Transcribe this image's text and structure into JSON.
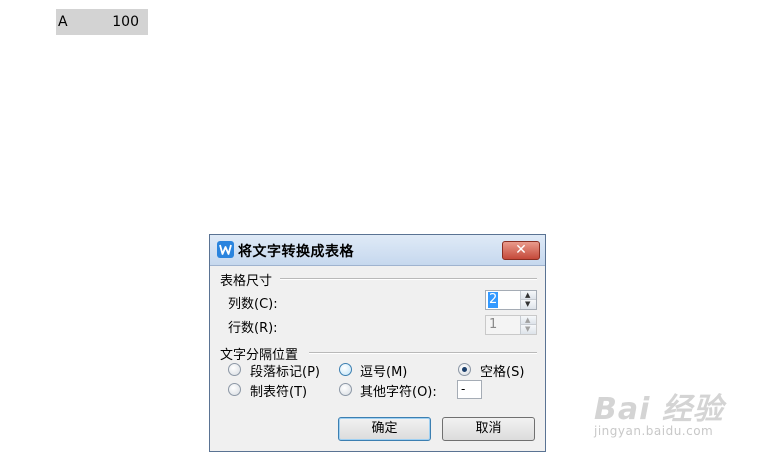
{
  "document": {
    "row": {
      "col1": "A",
      "col2": "100"
    }
  },
  "dialog": {
    "title": "将文字转换成表格",
    "close_glyph": "✕",
    "size_group": {
      "title": "表格尺寸",
      "columns_label": "列数(C):",
      "columns_value": "2",
      "rows_label": "行数(R):",
      "rows_value": "1"
    },
    "separator_group": {
      "title": "文字分隔位置",
      "options": [
        {
          "label": "段落标记(P)",
          "checked": false
        },
        {
          "label": "逗号(M)",
          "checked": false
        },
        {
          "label": "空格(S)",
          "checked": true
        },
        {
          "label": "制表符(T)",
          "checked": false
        },
        {
          "label": "其他字符(O):",
          "checked": false
        }
      ],
      "other_value": "-"
    },
    "ok_label": "确定",
    "cancel_label": "取消"
  },
  "watermark": {
    "main": "Bai 经验",
    "sub": "jingyan.baidu.com"
  },
  "colors": {
    "title_gradient_top": "#dfeaf7",
    "close_button": "#c5493a",
    "selection": "#3399ff",
    "dialog_bg": "#f0f0f0"
  }
}
